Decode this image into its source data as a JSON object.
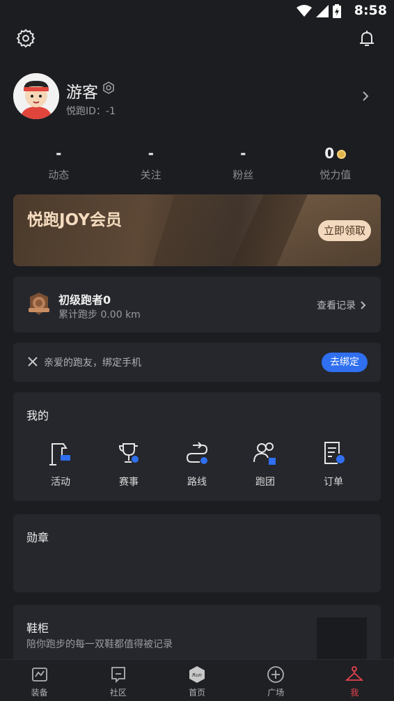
{
  "status_bar": {
    "time": "8:58"
  },
  "profile": {
    "name": "游客",
    "id_text": "悦跑ID：-1"
  },
  "stats": [
    {
      "value": "-",
      "label": "动态"
    },
    {
      "value": "-",
      "label": "关注"
    },
    {
      "value": "-",
      "label": "粉丝"
    },
    {
      "value": "0",
      "label": "悦力值"
    }
  ],
  "vip": {
    "title": "悦跑JOY会员",
    "button": "立即领取"
  },
  "rank": {
    "title": "初级跑者0",
    "subtitle": "累计跑步 0.00 km",
    "link": "查看记录"
  },
  "bind_phone": {
    "text": "亲爱的跑友，绑定手机",
    "button": "去绑定",
    "accent": "#2f6ff0"
  },
  "mine": {
    "title": "我的",
    "items": [
      {
        "label": "活动",
        "icon": "flag-icon"
      },
      {
        "label": "赛事",
        "icon": "trophy-icon"
      },
      {
        "label": "路线",
        "icon": "route-icon"
      },
      {
        "label": "跑团",
        "icon": "group-icon"
      },
      {
        "label": "订单",
        "icon": "order-icon"
      }
    ]
  },
  "medals": {
    "title": "勋章"
  },
  "shoes": {
    "title": "鞋柜",
    "subtitle": "陪你跑步的每一双鞋都值得被记录"
  },
  "bottom_nav": {
    "items": [
      {
        "label": "装备",
        "icon": "equipment-icon"
      },
      {
        "label": "社区",
        "icon": "community-icon"
      },
      {
        "label": "首页",
        "icon": "run-home-icon"
      },
      {
        "label": "广场",
        "icon": "plaza-icon"
      },
      {
        "label": "我",
        "icon": "me-icon"
      }
    ],
    "active_index": 4,
    "active_color": "#e8424f"
  }
}
